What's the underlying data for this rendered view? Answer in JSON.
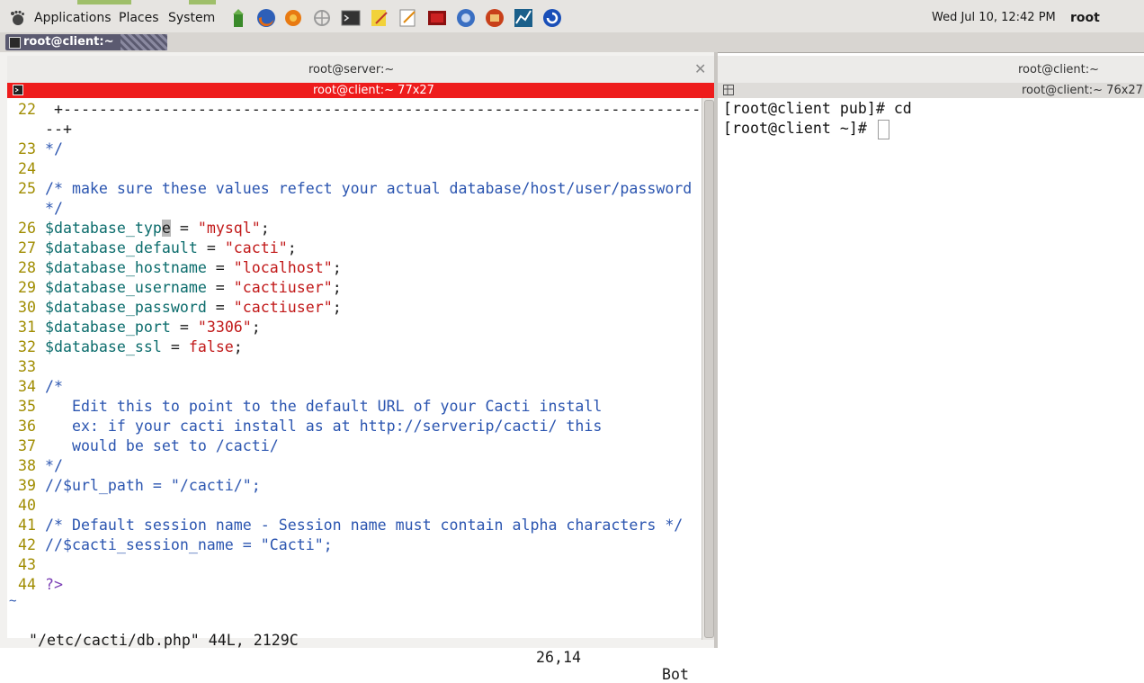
{
  "panel": {
    "menus": [
      "Applications",
      "Places",
      "System"
    ],
    "clock": "Wed Jul 10, 12:42 PM",
    "user": "root"
  },
  "taskbar": {
    "window_button": "root@client:~"
  },
  "left_window": {
    "title": "root@server:~",
    "tab_label": "root@client:~ 77x27",
    "editor_lines": [
      {
        "num": "22",
        "segments": [
          {
            "cls": "plain",
            "text": " +-----------------------------------------------------------------------"
          }
        ]
      },
      {
        "num": "",
        "segments": [
          {
            "cls": "plain",
            "text": "--+"
          }
        ]
      },
      {
        "num": "23",
        "segments": [
          {
            "cls": "cm",
            "text": "*/"
          }
        ]
      },
      {
        "num": "24",
        "segments": []
      },
      {
        "num": "25",
        "segments": [
          {
            "cls": "cm",
            "text": "/* make sure these values refect your actual database/host/user/password"
          }
        ]
      },
      {
        "num": "",
        "segments": [
          {
            "cls": "cm",
            "text": "*/"
          }
        ]
      },
      {
        "num": "26",
        "segments": [
          {
            "cls": "var",
            "text": "$database_typ"
          },
          {
            "cls": "cursor",
            "text": "e"
          },
          {
            "cls": "plain",
            "text": " = "
          },
          {
            "cls": "str",
            "text": "\"mysql\""
          },
          {
            "cls": "plain",
            "text": ";"
          }
        ]
      },
      {
        "num": "27",
        "segments": [
          {
            "cls": "var",
            "text": "$database_default"
          },
          {
            "cls": "plain",
            "text": " = "
          },
          {
            "cls": "str",
            "text": "\"cacti\""
          },
          {
            "cls": "plain",
            "text": ";"
          }
        ]
      },
      {
        "num": "28",
        "segments": [
          {
            "cls": "var",
            "text": "$database_hostname"
          },
          {
            "cls": "plain",
            "text": " = "
          },
          {
            "cls": "str",
            "text": "\"localhost\""
          },
          {
            "cls": "plain",
            "text": ";"
          }
        ]
      },
      {
        "num": "29",
        "segments": [
          {
            "cls": "var",
            "text": "$database_username"
          },
          {
            "cls": "plain",
            "text": " = "
          },
          {
            "cls": "str",
            "text": "\"cactiuser\""
          },
          {
            "cls": "plain",
            "text": ";"
          }
        ]
      },
      {
        "num": "30",
        "segments": [
          {
            "cls": "var",
            "text": "$database_password"
          },
          {
            "cls": "plain",
            "text": " = "
          },
          {
            "cls": "str",
            "text": "\"cactiuser\""
          },
          {
            "cls": "plain",
            "text": ";"
          }
        ]
      },
      {
        "num": "31",
        "segments": [
          {
            "cls": "var",
            "text": "$database_port"
          },
          {
            "cls": "plain",
            "text": " = "
          },
          {
            "cls": "str",
            "text": "\"3306\""
          },
          {
            "cls": "plain",
            "text": ";"
          }
        ]
      },
      {
        "num": "32",
        "segments": [
          {
            "cls": "var",
            "text": "$database_ssl"
          },
          {
            "cls": "plain",
            "text": " = "
          },
          {
            "cls": "kw",
            "text": "false"
          },
          {
            "cls": "plain",
            "text": ";"
          }
        ]
      },
      {
        "num": "33",
        "segments": []
      },
      {
        "num": "34",
        "segments": [
          {
            "cls": "cm",
            "text": "/*"
          }
        ]
      },
      {
        "num": "35",
        "segments": [
          {
            "cls": "cm",
            "text": "   Edit this to point to the default URL of your Cacti install"
          }
        ]
      },
      {
        "num": "36",
        "segments": [
          {
            "cls": "cm",
            "text": "   ex: if your cacti install as at http://serverip/cacti/ this"
          }
        ]
      },
      {
        "num": "37",
        "segments": [
          {
            "cls": "cm",
            "text": "   would be set to /cacti/"
          }
        ]
      },
      {
        "num": "38",
        "segments": [
          {
            "cls": "cm",
            "text": "*/"
          }
        ]
      },
      {
        "num": "39",
        "segments": [
          {
            "cls": "cm",
            "text": "//$url_path = \"/cacti/\";"
          }
        ]
      },
      {
        "num": "40",
        "segments": []
      },
      {
        "num": "41",
        "segments": [
          {
            "cls": "cm",
            "text": "/* Default session name - Session name must contain alpha characters */"
          }
        ]
      },
      {
        "num": "42",
        "segments": [
          {
            "cls": "cm",
            "text": "//$cacti_session_name = \"Cacti\";"
          }
        ]
      },
      {
        "num": "43",
        "segments": []
      },
      {
        "num": "44",
        "segments": [
          {
            "cls": "op",
            "text": "?>"
          }
        ]
      }
    ],
    "tilde": "~",
    "status_file": "\"/etc/cacti/db.php\" 44L, 2129C",
    "status_pos": "26,14",
    "status_bot": "Bot"
  },
  "right_window": {
    "title": "root@client:~",
    "tab_label": "root@client:~ 76x27",
    "lines": [
      "[root@client pub]# cd",
      "[root@client ~]# "
    ]
  }
}
